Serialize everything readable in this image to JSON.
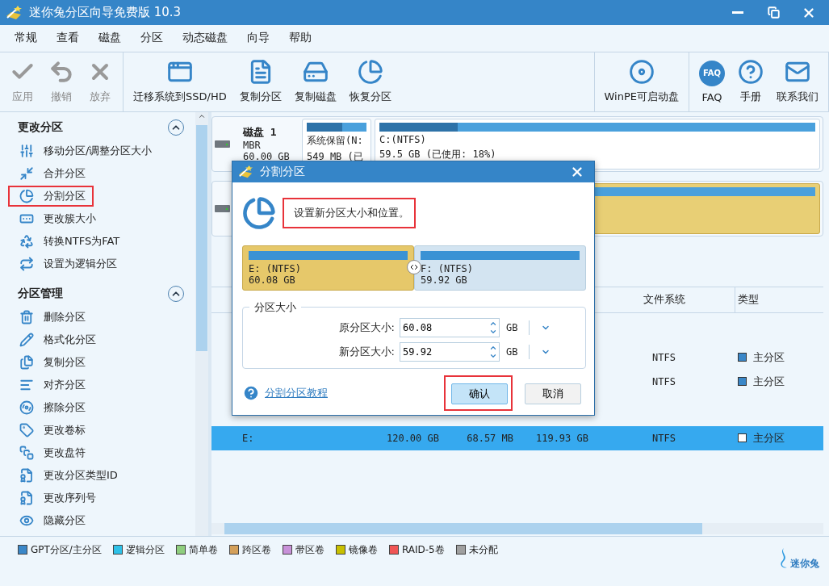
{
  "window": {
    "title": "迷你兔分区向导免费版 10.3"
  },
  "menu": [
    "常规",
    "查看",
    "磁盘",
    "分区",
    "动态磁盘",
    "向导",
    "帮助"
  ],
  "toolbar": [
    {
      "items": [
        {
          "label": "应用",
          "disabled": true
        },
        {
          "label": "撤销",
          "disabled": true
        },
        {
          "label": "放弃",
          "disabled": true
        }
      ]
    },
    {
      "items": [
        {
          "label": "迁移系统到SSD/HD",
          "disabled": false
        },
        {
          "label": "复制分区",
          "disabled": false
        },
        {
          "label": "复制磁盘",
          "disabled": false
        },
        {
          "label": "恢复分区",
          "disabled": false
        }
      ]
    },
    {
      "items": [
        {
          "label": "WinPE可启动盘",
          "disabled": false
        }
      ]
    },
    {
      "items": [
        {
          "label": "FAQ",
          "icon_text": "FAQ",
          "disabled": false
        },
        {
          "label": "手册",
          "disabled": false
        },
        {
          "label": "联系我们",
          "disabled": false
        }
      ]
    }
  ],
  "sidebar": {
    "sections": [
      {
        "title": "更改分区",
        "expanded": true,
        "items": [
          {
            "label": "移动分区/调整分区大小",
            "highlighted": false
          },
          {
            "label": "合并分区",
            "highlighted": false
          },
          {
            "label": "分割分区",
            "highlighted": true
          },
          {
            "label": "更改簇大小",
            "highlighted": false
          },
          {
            "label": "转换NTFS为FAT",
            "highlighted": false
          },
          {
            "label": "设置为逻辑分区",
            "highlighted": false
          }
        ]
      },
      {
        "title": "分区管理",
        "expanded": true,
        "items": [
          {
            "label": "删除分区",
            "highlighted": false
          },
          {
            "label": "格式化分区",
            "highlighted": false
          },
          {
            "label": "复制分区",
            "highlighted": false
          },
          {
            "label": "对齐分区",
            "highlighted": false
          },
          {
            "label": "擦除分区",
            "highlighted": false
          },
          {
            "label": "更改卷标",
            "highlighted": false
          },
          {
            "label": "更改盘符",
            "highlighted": false
          },
          {
            "label": "更改分区类型ID",
            "highlighted": false
          },
          {
            "label": "更改序列号",
            "highlighted": false
          },
          {
            "label": "隐藏分区",
            "highlighted": false
          }
        ]
      }
    ]
  },
  "disks": [
    {
      "name": "磁盘  1",
      "scheme": "MBR",
      "size": "60.00 GB",
      "partitions": [
        {
          "label": "系统保留(N:",
          "detail": "549 MB (已",
          "level": 0.6,
          "selected": false
        },
        {
          "label": "C:(NTFS)",
          "detail": "59.5 GB (已使用: 18%)",
          "level": 0.18,
          "selected": false
        }
      ]
    },
    {
      "partitions": [
        {
          "selected": true
        }
      ]
    }
  ],
  "table": {
    "header": [
      "文件系统",
      "类型"
    ],
    "groups": [
      {
        "rows": [
          {
            "file_system": "NTFS",
            "type": "主分区",
            "selected": false
          },
          {
            "file_system": "NTFS",
            "type": "主分区",
            "selected": false
          }
        ]
      },
      {
        "rows": [
          {
            "partition": "E:",
            "capacity": "120.00 GB",
            "used": "68.57 MB",
            "unused": "119.93 GB",
            "file_system": "NTFS",
            "type": "主分区",
            "selected": true
          }
        ]
      }
    ]
  },
  "dialog": {
    "title": "分割分区",
    "instruction": "设置新分区大小和位置。",
    "instruction_highlighted": true,
    "partitions": [
      {
        "label": "E: (NTFS)",
        "size": "60.08 GB",
        "selected": true
      },
      {
        "label": "F: (NTFS)",
        "size": "59.92 GB",
        "selected": false
      }
    ],
    "group_title": "分区大小",
    "fields": [
      {
        "label": "原分区大小:",
        "value": "60.08",
        "unit": "GB"
      },
      {
        "label": "新分区大小:",
        "value": "59.92",
        "unit": "GB"
      }
    ],
    "help_link": "分割分区教程",
    "buttons": [
      {
        "label": "确认",
        "primary": true,
        "highlighted": true
      },
      {
        "label": "取消",
        "primary": false,
        "highlighted": false
      }
    ]
  },
  "legend": [
    {
      "label": "GPT分区/主分区",
      "color": "#3a87c8"
    },
    {
      "label": "逻辑分区",
      "color": "#2ec1e8"
    },
    {
      "label": "简单卷",
      "color": "#8fce7e"
    },
    {
      "label": "跨区卷",
      "color": "#d4a05a"
    },
    {
      "label": "带区卷",
      "color": "#c891d9"
    },
    {
      "label": "镜像卷",
      "color": "#c8c000"
    },
    {
      "label": "RAID-5卷",
      "color": "#f05555"
    },
    {
      "label": "未分配",
      "color": "#a0a0a0"
    }
  ],
  "logo": {
    "text": "迷你兔"
  }
}
